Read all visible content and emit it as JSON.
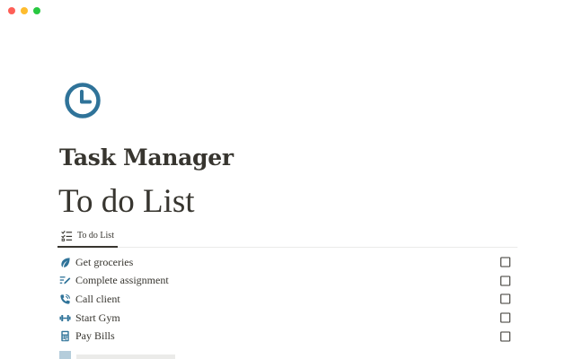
{
  "window": {
    "controls": [
      "close",
      "minimize",
      "zoom"
    ]
  },
  "page": {
    "icon": "clock-icon",
    "title": "Task Manager"
  },
  "database": {
    "title": "To do List",
    "view_tab": {
      "label": "To do List",
      "icon": "checklist-icon"
    },
    "rows": [
      {
        "label": "Get groceries",
        "icon": "leaf-icon",
        "done": false
      },
      {
        "label": "Complete assignment",
        "icon": "pencil-lines-icon",
        "done": false
      },
      {
        "label": "Call client",
        "icon": "phone-icon",
        "done": false
      },
      {
        "label": "Start Gym",
        "icon": "dumbbell-icon",
        "done": false
      },
      {
        "label": "Pay Bills",
        "icon": "calculator-icon",
        "done": false
      }
    ]
  },
  "colors": {
    "accent": "#2f7399",
    "text": "#37352f",
    "divider": "#ebebea"
  }
}
